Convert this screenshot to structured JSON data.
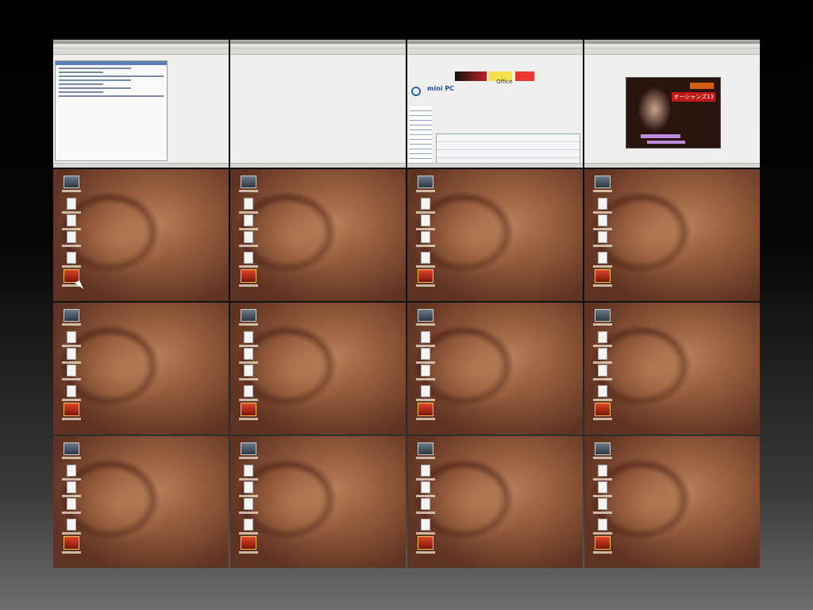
{
  "wall": {
    "columns": 4,
    "rows": 4,
    "active_workspace": 5
  },
  "workspaces": [
    {
      "id": 1,
      "kind": "window",
      "app": "editor"
    },
    {
      "id": 2,
      "kind": "window",
      "app": "blank-browser"
    },
    {
      "id": 3,
      "kind": "window",
      "app": "browser"
    },
    {
      "id": 4,
      "kind": "window",
      "app": "video-player"
    },
    {
      "id": 5,
      "kind": "desktop"
    },
    {
      "id": 6,
      "kind": "desktop"
    },
    {
      "id": 7,
      "kind": "desktop"
    },
    {
      "id": 8,
      "kind": "desktop"
    },
    {
      "id": 9,
      "kind": "desktop"
    },
    {
      "id": 10,
      "kind": "desktop"
    },
    {
      "id": 11,
      "kind": "desktop"
    },
    {
      "id": 12,
      "kind": "desktop"
    },
    {
      "id": 13,
      "kind": "desktop"
    },
    {
      "id": 14,
      "kind": "desktop"
    },
    {
      "id": 15,
      "kind": "desktop"
    },
    {
      "id": 16,
      "kind": "desktop"
    }
  ],
  "desktop_icons": [
    {
      "icon": "computer-icon"
    },
    {
      "icon": "document-icon"
    },
    {
      "icon": "document-icon"
    },
    {
      "icon": "document-icon"
    },
    {
      "icon": "document-icon"
    },
    {
      "icon": "video-file-icon"
    }
  ],
  "browser": {
    "site_name": "mini PC",
    "banner_text": "Office"
  },
  "video": {
    "overlay_text": "オーシャンズ13"
  },
  "colors": {
    "wallpaper": "#8a5236",
    "window_bg": "#f0efed",
    "link_blue": "#1a4fa0"
  }
}
